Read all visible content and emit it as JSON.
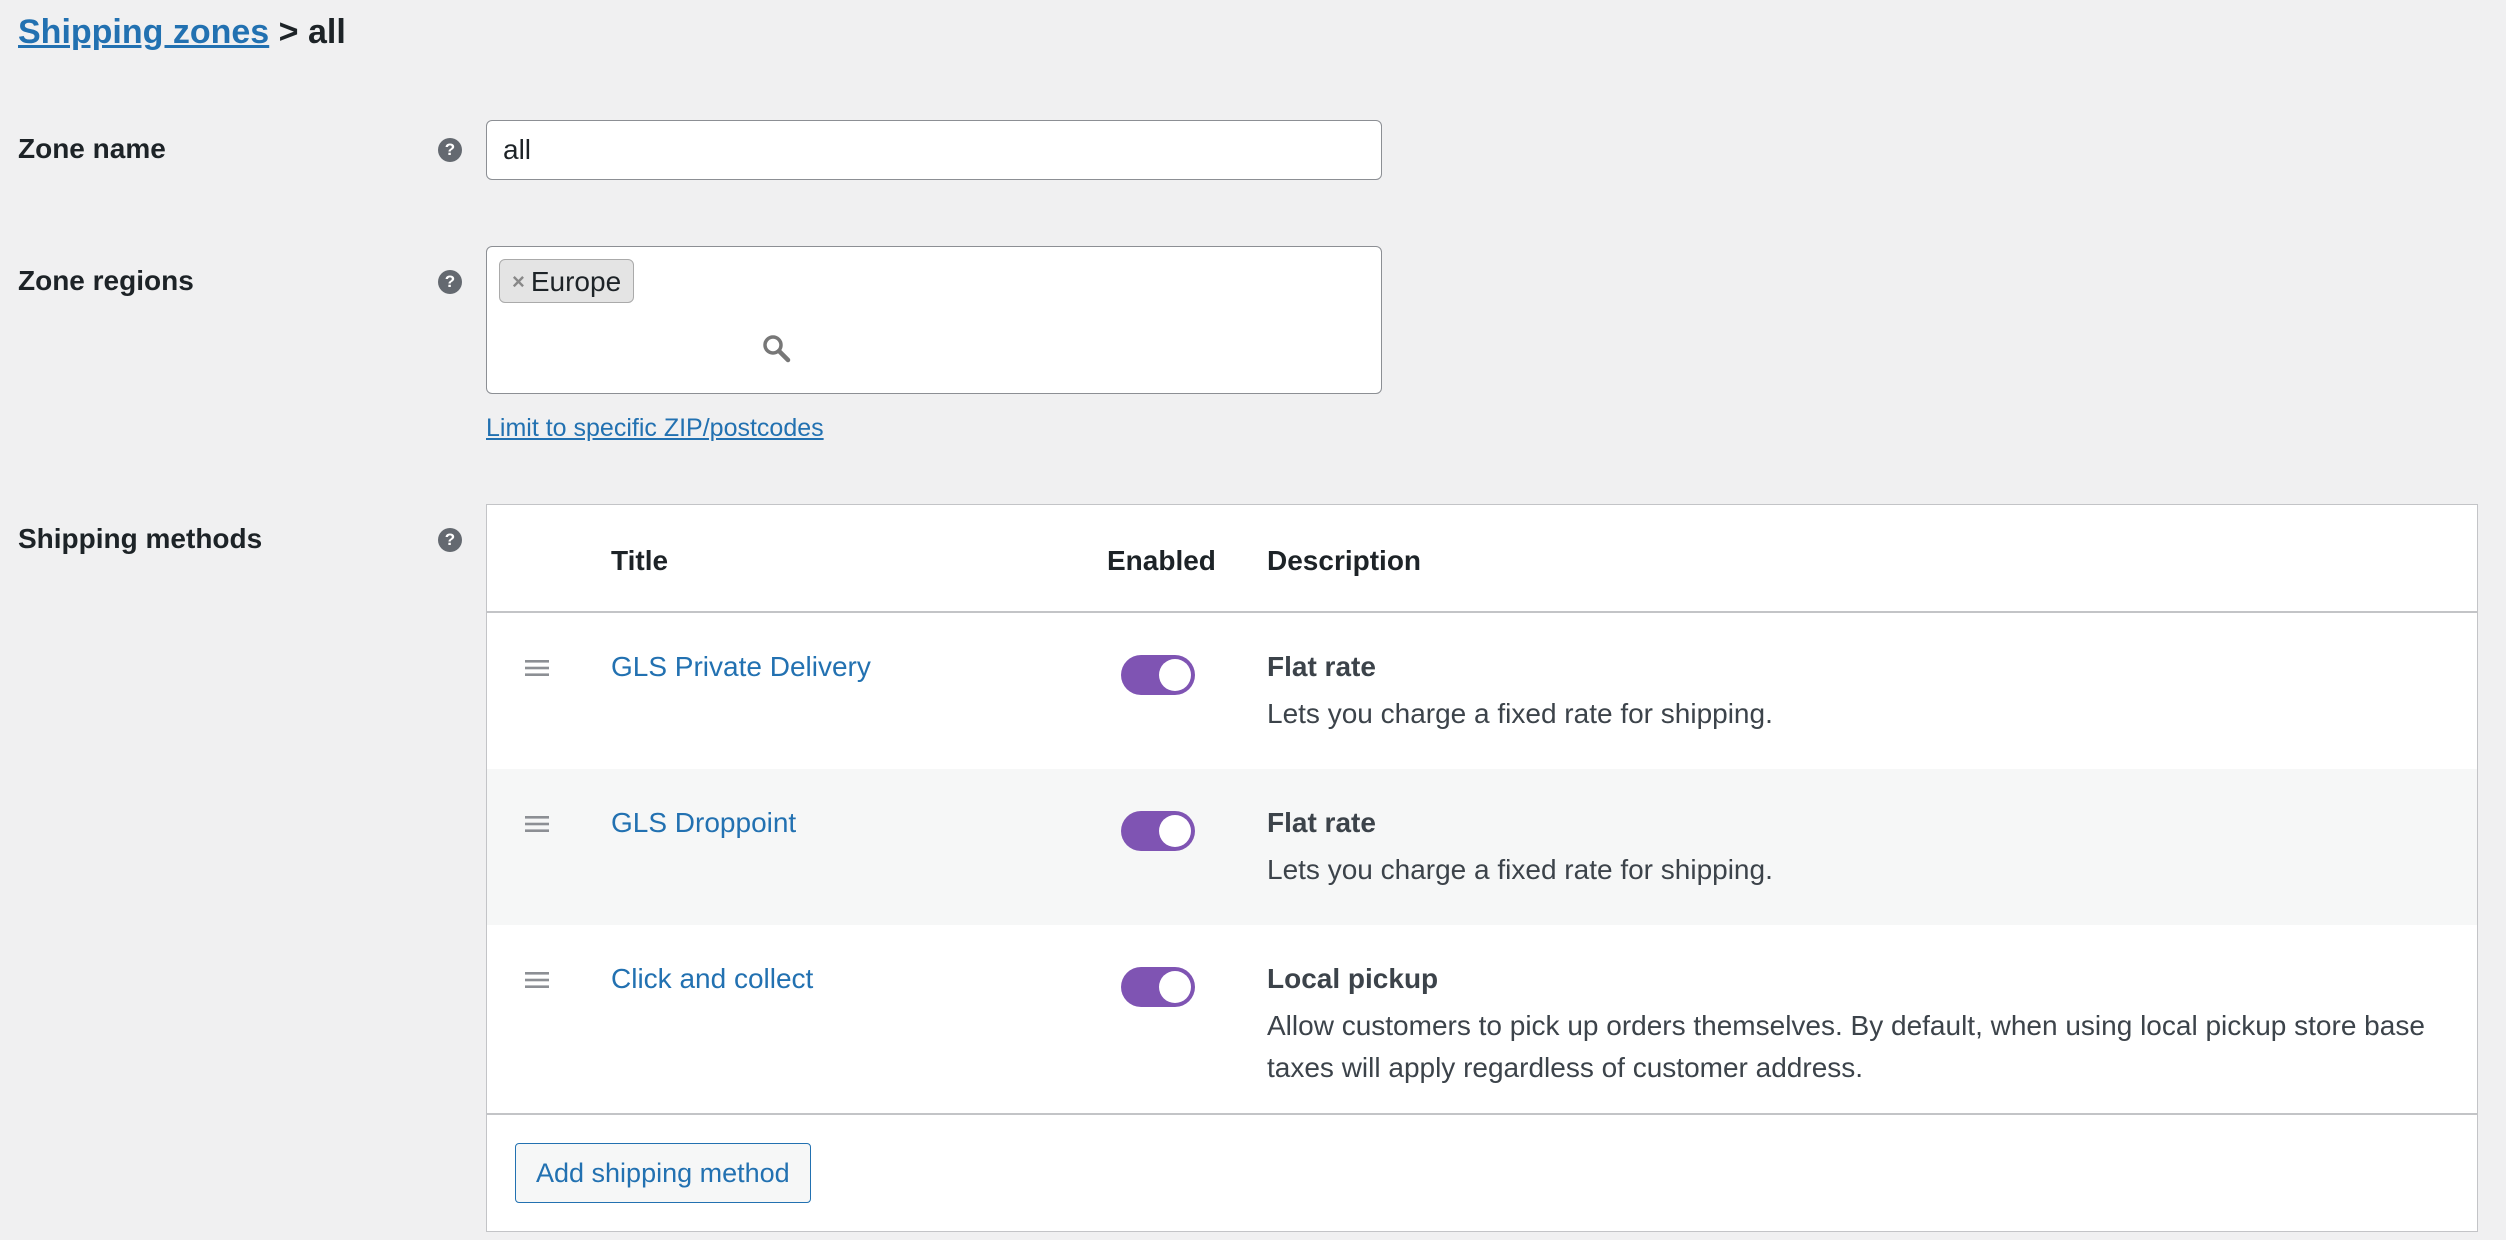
{
  "breadcrumb": {
    "parent_label": "Shipping zones",
    "separator": ">",
    "current": "all"
  },
  "zone_name": {
    "label": "Zone name",
    "value": "all"
  },
  "zone_regions": {
    "label": "Zone regions",
    "tags": [
      {
        "remove_symbol": "×",
        "label": "Europe"
      }
    ],
    "limit_link": "Limit to specific ZIP/postcodes"
  },
  "shipping_methods": {
    "label": "Shipping methods",
    "columns": {
      "title": "Title",
      "enabled": "Enabled",
      "description": "Description"
    },
    "rows": [
      {
        "title": "GLS Private Delivery",
        "enabled": true,
        "type": "Flat rate",
        "description": "Lets you charge a fixed rate for shipping."
      },
      {
        "title": "GLS Droppoint",
        "enabled": true,
        "type": "Flat rate",
        "description": "Lets you charge a fixed rate for shipping."
      },
      {
        "title": "Click and collect",
        "enabled": true,
        "type": "Local pickup",
        "description": "Allow customers to pick up orders themselves. By default, when using local pickup store base taxes will apply regardless of customer address."
      }
    ],
    "add_button": "Add shipping method"
  },
  "help_symbol": "?",
  "colors": {
    "link": "#2271b1",
    "toggle_on": "#7f54b3",
    "page_bg": "#f0f0f1"
  }
}
